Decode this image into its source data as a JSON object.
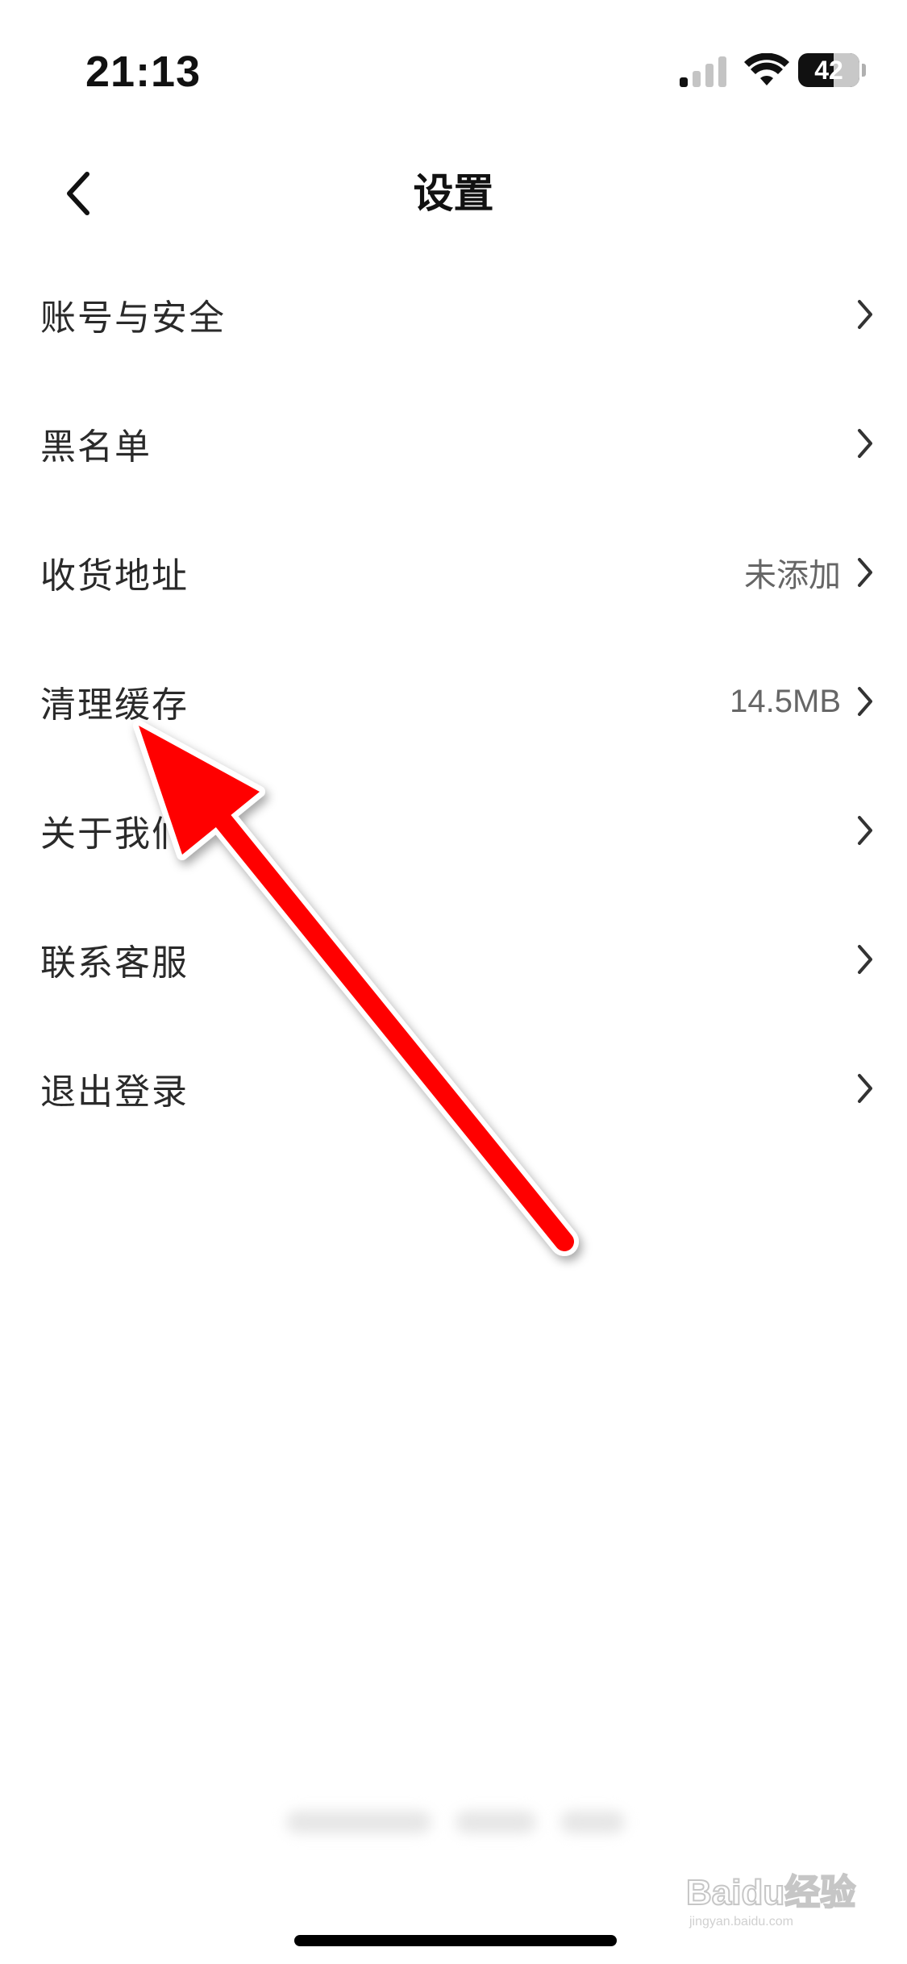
{
  "status_bar": {
    "time": "21:13",
    "battery_level": "42"
  },
  "nav": {
    "title": "设置"
  },
  "settings": [
    {
      "label": "账号与安全",
      "value": ""
    },
    {
      "label": "黑名单",
      "value": ""
    },
    {
      "label": "收货地址",
      "value": "未添加"
    },
    {
      "label": "清理缓存",
      "value": "14.5MB"
    },
    {
      "label": "关于我们",
      "value": ""
    },
    {
      "label": "联系客服",
      "value": ""
    },
    {
      "label": "退出登录",
      "value": ""
    }
  ],
  "watermark": {
    "text": "Baidu经验",
    "subtext": "jingyan.baidu.com"
  },
  "colors": {
    "annotation_arrow": "#ff0000",
    "text_primary": "#2a2a2a",
    "text_secondary": "#666666"
  }
}
